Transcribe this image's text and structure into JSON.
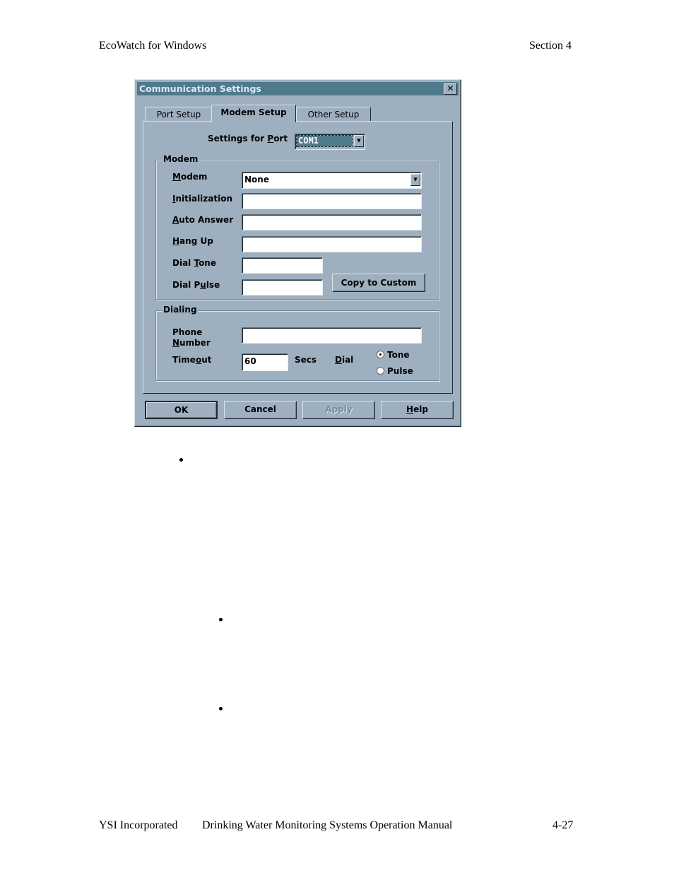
{
  "page": {
    "header_left": "EcoWatch for Windows",
    "header_right": "Section 4",
    "footer_left": "YSI Incorporated",
    "footer_center": "Drinking Water Monitoring Systems Operation Manual",
    "footer_right": "4-27"
  },
  "dialog": {
    "title": "Communication Settings",
    "close_glyph": "✕",
    "tabs": [
      {
        "label": "Port Setup",
        "active": false
      },
      {
        "label": "Modem Setup",
        "active": true
      },
      {
        "label": "Other Setup",
        "active": false
      }
    ],
    "port": {
      "label_pre": "Settings for ",
      "label_u": "P",
      "label_post": "ort",
      "value": "COM1"
    },
    "modem_group": {
      "title": "Modem",
      "modem": {
        "label_u": "M",
        "label_post": "odem",
        "value": "None"
      },
      "initialization": {
        "label_u": "I",
        "label_post": "nitialization",
        "value": ""
      },
      "auto_answer": {
        "label_u": "A",
        "label_post": "uto Answer",
        "value": ""
      },
      "hang_up": {
        "label_u": "H",
        "label_post": "ang Up",
        "value": ""
      },
      "dial_tone": {
        "label_pre": "Dial ",
        "label_u": "T",
        "label_post": "one",
        "value": ""
      },
      "dial_pulse": {
        "label_pre": "Dial P",
        "label_u": "u",
        "label_post": "lse",
        "value": ""
      },
      "copy_button": "Copy to Custom"
    },
    "dialing_group": {
      "title": "Dialing",
      "phone_label_1": "Phone",
      "phone_label_2_u": "N",
      "phone_label_2_post": "umber",
      "phone_value": "",
      "timeout_pre": "Time",
      "timeout_u": "o",
      "timeout_post": "ut",
      "timeout_value": "60",
      "secs_label": "Secs",
      "dial_u": "D",
      "dial_post": "ial",
      "radio_tone": "Tone",
      "radio_pulse": "Pulse",
      "selected": "Tone"
    },
    "buttons": {
      "ok": "OK",
      "cancel": "Cancel",
      "apply_u": "A",
      "apply_post": "pply",
      "help_u": "H",
      "help_post": "elp"
    }
  }
}
